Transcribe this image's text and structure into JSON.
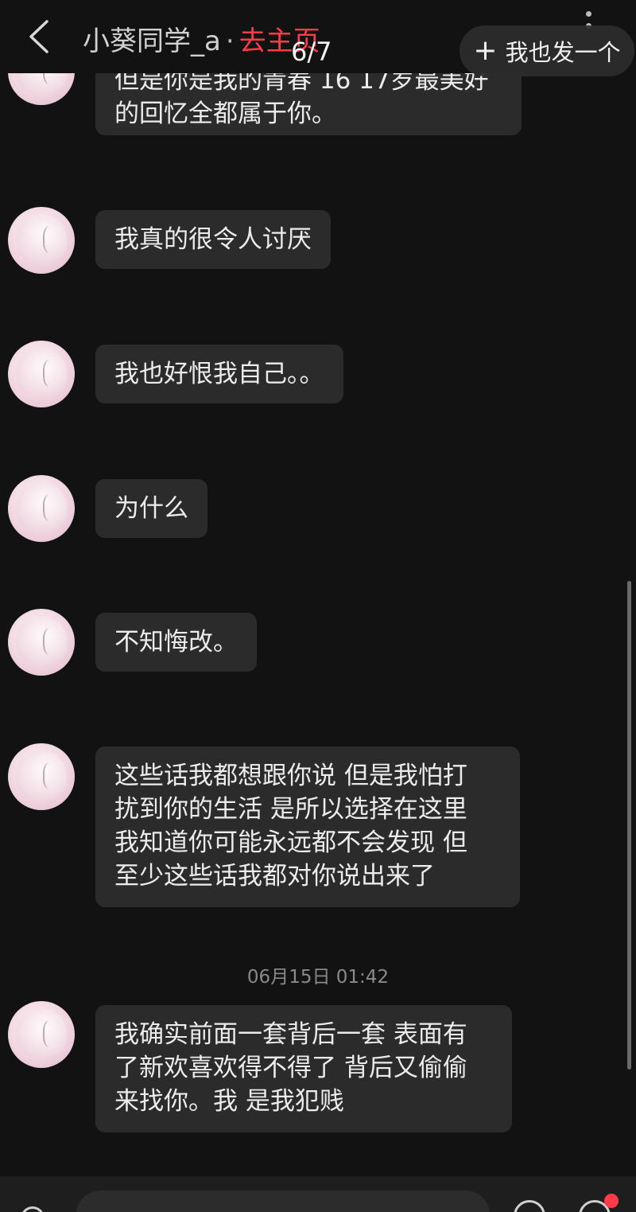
{
  "header": {
    "title": "小葵同学_a",
    "separator": "·",
    "homepage_link": "去主页",
    "page_counter": "6/7",
    "post_button": {
      "icon": "+",
      "label": "我也发一个"
    },
    "back_icon": "chevron-left-icon",
    "more_icon": "more-vertical-icon"
  },
  "messages": [
    {
      "text": "但是你是我的青春 16 17岁最美好\n的回忆全都属于你。"
    },
    {
      "text": "我真的很令人讨厌"
    },
    {
      "text": "我也好恨我自己。。"
    },
    {
      "text": "为什么"
    },
    {
      "text": "不知悔改。"
    },
    {
      "text": "这些话我都想跟你说 但是我怕打\n扰到你的生活 是所以选择在这里\n我知道你可能永远都不会发现 但\n至少这些话我都对你说出来了"
    },
    {
      "text": "我确实前面一套背后一套 表面有\n了新欢喜欢得不得了 背后又偷偷\n来找你。我 是我犯贱"
    }
  ],
  "timestamp": "06月15日 01:42",
  "colors": {
    "background": "#121212",
    "bubble": "#2b2b2b",
    "accent": "#ff3b4a"
  }
}
